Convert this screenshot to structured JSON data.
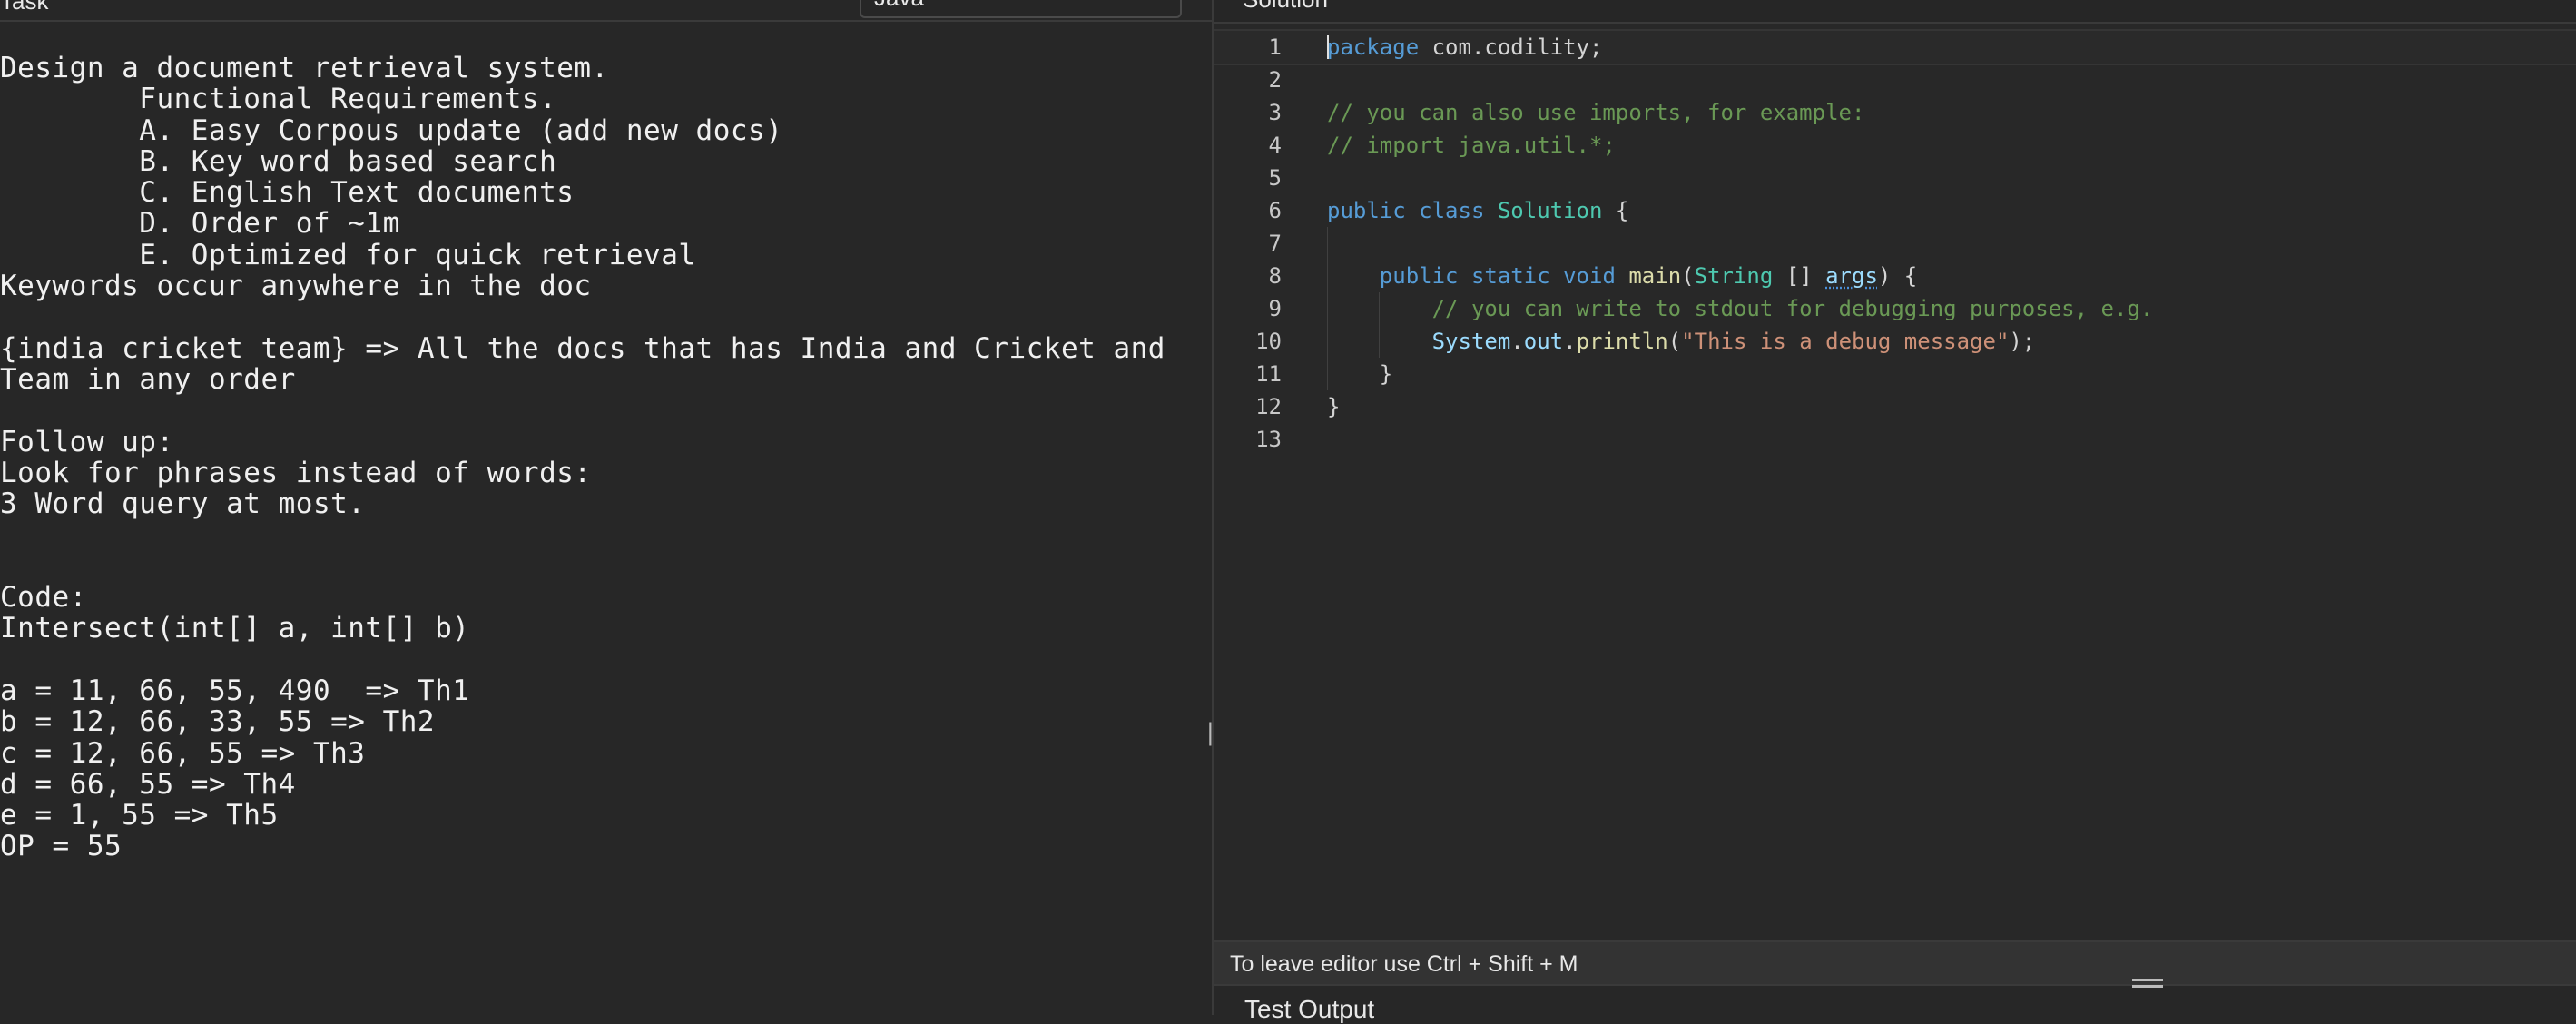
{
  "task_panel": {
    "title": "Task",
    "language": "Java",
    "description_lines": [
      "Design a document retrieval system.",
      "        Functional Requirements.",
      "        A. Easy Corpous update (add new docs)",
      "        B. Key word based search",
      "        C. English Text documents",
      "        D. Order of ~1m",
      "        E. Optimized for quick retrieval",
      "Keywords occur anywhere in the doc",
      "",
      "{india cricket team} => All the docs that has India and Cricket and",
      "Team in any order",
      "",
      "Follow up:",
      "Look for phrases instead of words:",
      "3 Word query at most.",
      "",
      "",
      "Code:",
      "Intersect(int[] a, int[] b)",
      "",
      "a = 11, 66, 55, 490  => Th1",
      "b = 12, 66, 33, 55 => Th2",
      "c = 12, 66, 55 => Th3",
      "d = 66, 55 => Th4",
      "e = 1, 55 => Th5",
      "OP = 55"
    ]
  },
  "splitter": {
    "handle_glyph": "||"
  },
  "editor": {
    "title": "Solution",
    "lines": [
      {
        "n": "1",
        "tokens": [
          [
            "kw",
            "package"
          ],
          [
            "plain",
            " com.codility;"
          ]
        ]
      },
      {
        "n": "2",
        "tokens": []
      },
      {
        "n": "3",
        "tokens": [
          [
            "cm",
            "// you can also use imports, for example:"
          ]
        ]
      },
      {
        "n": "4",
        "tokens": [
          [
            "cm",
            "// import java.util.*;"
          ]
        ]
      },
      {
        "n": "5",
        "tokens": []
      },
      {
        "n": "6",
        "tokens": [
          [
            "kw",
            "public"
          ],
          [
            "plain",
            " "
          ],
          [
            "kw",
            "class"
          ],
          [
            "plain",
            " "
          ],
          [
            "cls",
            "Solution"
          ],
          [
            "plain",
            " {"
          ]
        ]
      },
      {
        "n": "7",
        "tokens": []
      },
      {
        "n": "8",
        "tokens": [
          [
            "plain",
            "    "
          ],
          [
            "kw",
            "public"
          ],
          [
            "plain",
            " "
          ],
          [
            "kw",
            "static"
          ],
          [
            "plain",
            " "
          ],
          [
            "kw",
            "void"
          ],
          [
            "plain",
            " "
          ],
          [
            "fn",
            "main"
          ],
          [
            "plain",
            "("
          ],
          [
            "cls",
            "String"
          ],
          [
            "plain",
            " [] "
          ],
          [
            "var-squig",
            "args"
          ],
          [
            "plain",
            ") {"
          ]
        ]
      },
      {
        "n": "9",
        "tokens": [
          [
            "plain",
            "        "
          ],
          [
            "cm",
            "// you can write to stdout for debugging purposes, e.g."
          ]
        ]
      },
      {
        "n": "10",
        "tokens": [
          [
            "plain",
            "        "
          ],
          [
            "var",
            "System"
          ],
          [
            "plain",
            "."
          ],
          [
            "var",
            "out"
          ],
          [
            "plain",
            "."
          ],
          [
            "fn",
            "println"
          ],
          [
            "plain",
            "("
          ],
          [
            "str",
            "\"This is a debug message\""
          ],
          [
            "plain",
            ");"
          ]
        ]
      },
      {
        "n": "11",
        "tokens": [
          [
            "plain",
            "    }"
          ]
        ]
      },
      {
        "n": "12",
        "tokens": [
          [
            "plain",
            "}"
          ]
        ]
      },
      {
        "n": "13",
        "tokens": []
      }
    ],
    "status_hint": "To leave editor use Ctrl + Shift + M"
  },
  "test_output": {
    "label": "Test Output"
  }
}
